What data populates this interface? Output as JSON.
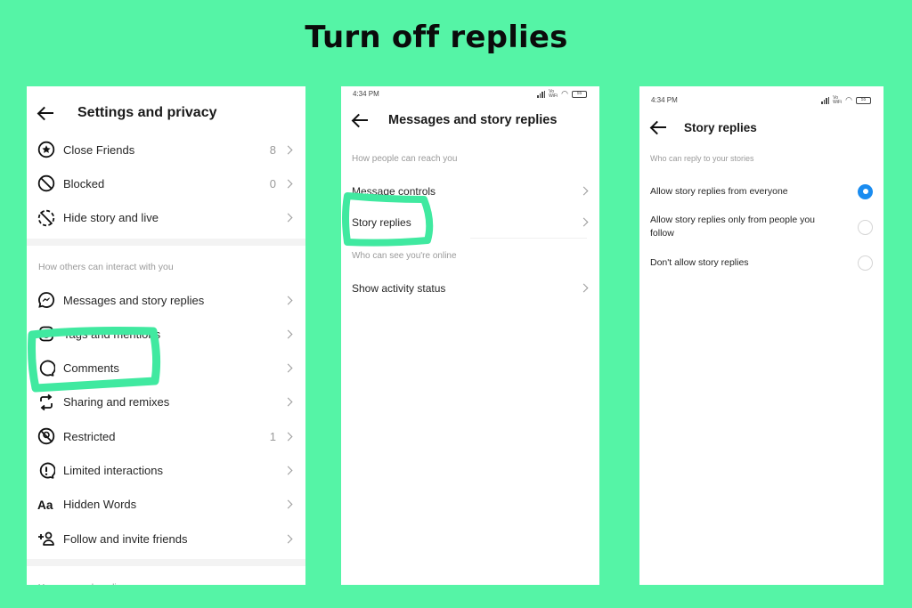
{
  "page_title": "Turn off replies",
  "annotation_color": "#40e9a0",
  "accent_color": "#1a8cf0",
  "panel_settings": {
    "header": {
      "title": "Settings and privacy"
    },
    "group1": [
      {
        "icon": "star-circle-icon",
        "label": "Close Friends",
        "count": "8"
      },
      {
        "icon": "blocked-icon",
        "label": "Blocked",
        "count": "0"
      },
      {
        "icon": "hide-story-icon",
        "label": "Hide story and live",
        "count": ""
      }
    ],
    "section2_label": "How others can interact with you",
    "group2": [
      {
        "icon": "messenger-icon",
        "label": "Messages and story replies",
        "count": ""
      },
      {
        "icon": "tag-icon",
        "label": "Tags and mentions",
        "count": ""
      },
      {
        "icon": "comment-icon",
        "label": "Comments",
        "count": ""
      },
      {
        "icon": "share-remix-icon",
        "label": "Sharing and remixes",
        "count": ""
      },
      {
        "icon": "restricted-icon",
        "label": "Restricted",
        "count": "1"
      },
      {
        "icon": "limited-interactions-icon",
        "label": "Limited interactions",
        "count": ""
      },
      {
        "icon": "hidden-words-icon",
        "label": "Hidden Words",
        "count": ""
      },
      {
        "icon": "add-friend-icon",
        "label": "Follow and invite friends",
        "count": ""
      }
    ],
    "section3_label": "Your app and media"
  },
  "panel_messages": {
    "status": {
      "time": "4:34 PM",
      "network": "Vo WiFi",
      "battery": "55"
    },
    "header": {
      "title": "Messages and story replies"
    },
    "section1_label": "How people can reach you",
    "items1": [
      {
        "label": "Message controls"
      },
      {
        "label": "Story replies"
      }
    ],
    "section2_label": "Who can see you're online",
    "items2": [
      {
        "label": "Show activity status"
      }
    ]
  },
  "panel_story": {
    "status": {
      "time": "4:34 PM",
      "network": "Vo WiFi",
      "battery": "55"
    },
    "header": {
      "title": "Story replies"
    },
    "section_label": "Who can reply to your stories",
    "options": [
      {
        "label": "Allow story replies from everyone",
        "selected": true
      },
      {
        "label": "Allow story replies only from people you follow",
        "selected": false
      },
      {
        "label": "Don't allow story replies",
        "selected": false
      }
    ]
  }
}
